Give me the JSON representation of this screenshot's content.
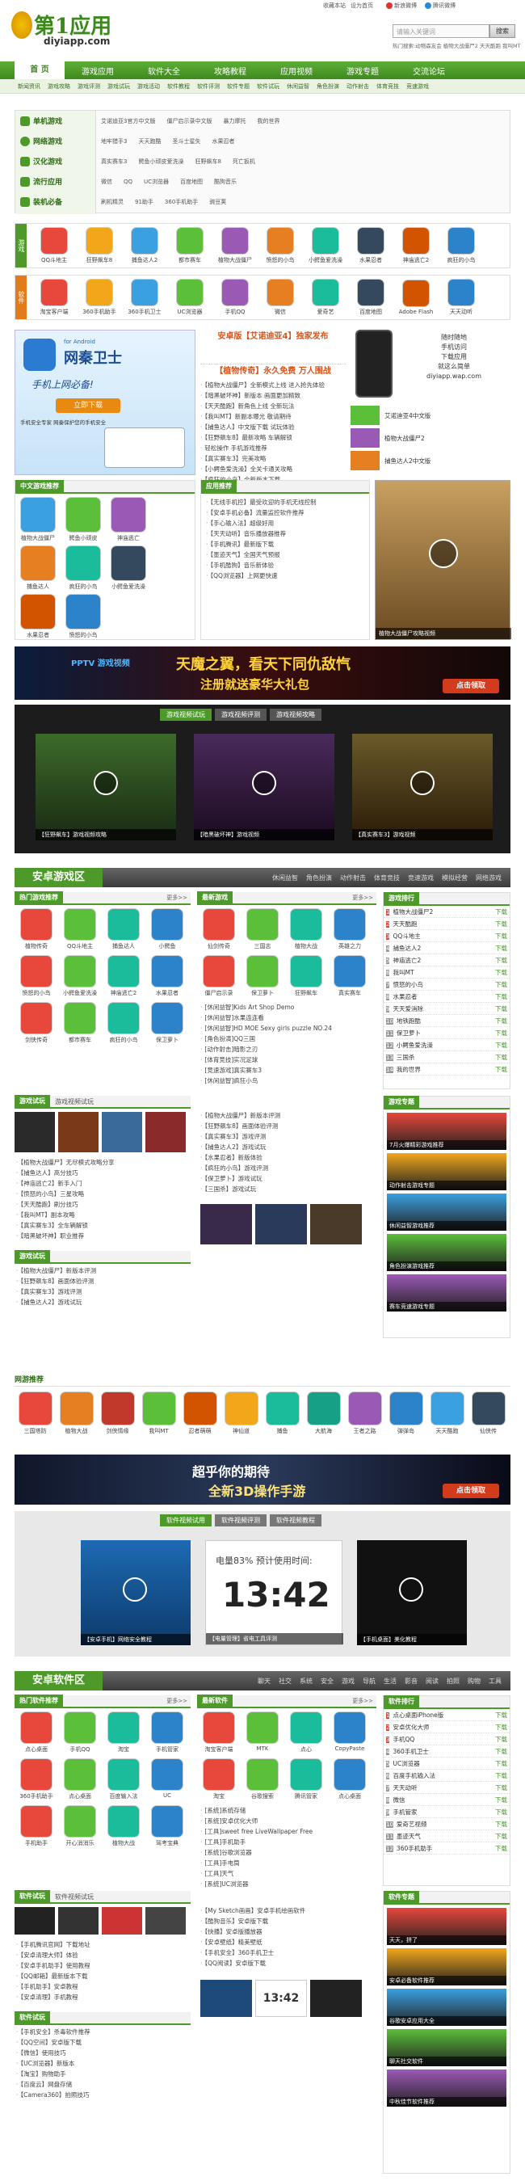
{
  "site": {
    "logo_cn": "第1应用",
    "logo_url": "diyiapp.com",
    "top_links": [
      "收藏本站",
      "设为首页"
    ],
    "weibo": [
      "新浪微博",
      "腾讯微博"
    ],
    "search_placeholder": "请输入关键词",
    "search_button": "搜索",
    "hotwords": "热门搜索:动物森友会 植物大战僵尸2 天天酷跑 我叫MT"
  },
  "nav": [
    "首 页",
    "游戏应用",
    "软件大全",
    "攻略教程",
    "应用视频",
    "游戏专题",
    "交流论坛"
  ],
  "subnav": [
    "新闻资讯",
    "游戏攻略",
    "游戏评测",
    "游戏试玩",
    "游戏活动",
    "软件教程",
    "软件评测",
    "软件专题",
    "软件试玩",
    "休闲益智",
    "角色扮演",
    "动作射击",
    "体育竞技",
    "竞速游戏"
  ],
  "categories": [
    "单机游戏",
    "网络游戏",
    "汉化游戏",
    "流行应用",
    "装机必备"
  ],
  "category_links": [
    [
      "艾诺迪亚3官方中文版",
      "僵尸启示录中文版",
      "暴力摩托",
      "我的世界"
    ],
    [
      "地牢猎手3",
      "天天跑酷",
      "圣斗士星矢",
      "水果忍者"
    ],
    [
      "真实赛车3",
      "鳄鱼小顽皮爱洗澡",
      "狂野飙车8",
      "死亡扳机"
    ],
    [
      "微信",
      "QQ",
      "UC浏览器",
      "百度地图",
      "酷狗音乐"
    ],
    [
      "刷机精灵",
      "91助手",
      "360手机助手",
      "豌豆荚"
    ]
  ],
  "game_row": [
    "QQ斗地主",
    "狂野飙车8",
    "捕鱼达人2",
    "都市赛车",
    "植物大战僵尸",
    "愤怒的小鸟",
    "小鳄鱼爱洗澡",
    "水果忍者",
    "神庙逃亡2",
    "疯狂的小鸟"
  ],
  "app_row": [
    "淘宝客户端",
    "360手机助手",
    "360手机卫士",
    "UC浏览器",
    "手机QQ",
    "微信",
    "爱奇艺",
    "百度地图",
    "Adobe Flash",
    "天天动听"
  ],
  "feature": {
    "ad_title": "网秦卫士",
    "ad_sub": "for Android",
    "ad_tag": "手机上网必备!",
    "ad_btn": "立即下载",
    "ad_desc": "手机安全专家 网秦保护您的手机安全",
    "headline1": "安卓版【艾诺迪亚4】独家发布",
    "headline2": "【植物传奇】永久免费 万人围战",
    "news": [
      "【植物大战僵尸】全新模式上线 进入抢先体验",
      "【暗黑破坏神】新版本 画面更加精致",
      "【天天酷跑】新角色上线 全新玩法",
      "【我叫MT】新副本曝光 敬请期待",
      "【捕鱼达人】中文版下载 试玩体验",
      "【狂野飙车8】最新攻略 车辆解锁",
      "轻松操作 手机游戏推荐",
      "【真实赛车3】完美攻略",
      "【小鳄鱼爱洗澡】全关卡通关攻略",
      "【疯狂的小鸟】全新版本下载"
    ],
    "phone_text": [
      "随时随地",
      "手机访问",
      "下载应用",
      "就这么简单",
      "diyiapp.wap.com"
    ],
    "side_items": [
      "艾诺迪亚4中文版",
      "植物大战僵尸2",
      "捕鱼达人2中文版"
    ]
  },
  "panels": {
    "left_title": "中文游戏推荐",
    "mid_title": "应用推荐",
    "mid_list": [
      "【无线手机控】最受欢迎的手机无线控制",
      "【安卓手机必备】流量监控软件推荐",
      "【手心输入法】超级好用",
      "【天天动听】音乐播放器推荐",
      "【手机腾讯】最新版下载",
      "【墨迹天气】全国天气预报",
      "【手机酷狗】音乐新体验",
      "【QQ浏览器】上网更快速"
    ],
    "left_items": [
      "植物大战僵尸",
      "鳄鱼小顽皮",
      "神庙逃亡",
      "捕鱼达人",
      "疯狂的小鸟",
      "小鳄鱼爱洗澡",
      "水果忍者",
      "愤怒的小鸟"
    ],
    "right_cap": "植物大战僵尸攻略视频"
  },
  "banner1": {
    "left": "PPTV 游戏视频",
    "text": "天魔之翼，看天下同仇敌忾",
    "sub": "注册就送豪华大礼包",
    "btn": "点击领取"
  },
  "video_tabs": [
    "游戏视频试玩",
    "游戏视频评测",
    "游戏视频攻略"
  ],
  "videos": [
    {
      "cap": "【狂野飙车】游戏视频攻略"
    },
    {
      "cap": "【暗黑破坏神】游戏视频"
    },
    {
      "cap": "【真实赛车3】游戏视频"
    }
  ],
  "android_games": {
    "title": "安卓游戏区",
    "tabs": [
      "休闲益智",
      "角色扮演",
      "动作射击",
      "体育竞技",
      "竞速游戏",
      "模拟经营",
      "网络游戏"
    ],
    "hot_title": "热门游戏推荐",
    "new_title": "最新游戏",
    "more": "更多>>",
    "hot": [
      "植物传奇",
      "QQ斗地主",
      "捕鱼达人",
      "小鳄鱼",
      "愤怒的小鸟",
      "小鳄鱼爱洗澡",
      "神庙逃亡2",
      "水果忍者",
      "剑侠传奇",
      "都市赛车",
      "疯狂的小鸟",
      "保卫萝卜"
    ],
    "latest": [
      "仙剑传奇",
      "三国志",
      "植物大战",
      "英雄之力",
      "僵尸启示录",
      "保卫萝卜",
      "狂野飙车",
      "真实赛车"
    ],
    "latest_list": [
      "[休闲益智]Kids Art Shop Demo",
      "[休闲益智]水果连连看",
      "[休闲益智]HD MOE Sexy girls puzzle NO.24",
      "[角色扮演]QQ三国",
      "[动作射击]暗影之刃",
      "[体育竞技]实况足球",
      "[竞速游戏]真实赛车3",
      "[休闲益智]疯狂小鸟"
    ],
    "rank_title": "游戏排行",
    "rank": [
      "植物大战僵尸2",
      "天天酷跑",
      "QQ斗地主",
      "捕鱼达人2",
      "神庙逃亡2",
      "我叫MT",
      "愤怒的小鸟",
      "水果忍者",
      "天天爱消除",
      "地铁跑酷",
      "保卫萝卜",
      "小鳄鱼爱洗澡",
      "三国杀",
      "我的世界"
    ],
    "rank_dl": "下载",
    "topic_title": "游戏专题",
    "topics": [
      "7月火爆精彩游戏推荐",
      "动作射击游戏专题",
      "休闲益智游戏推荐",
      "角色扮演游戏推荐",
      "赛车竞速游戏专题"
    ]
  },
  "game_news": {
    "tabs": [
      "游戏试玩",
      "游戏视频试玩"
    ],
    "list": [
      "【植物大战僵尸】无尽模式攻略分享",
      "【捕鱼达人】高分技巧",
      "【神庙逃亡2】新手入门",
      "【愤怒的小鸟】三星攻略",
      "【天天酷跑】刷分技巧",
      "【我叫MT】副本攻略",
      "【真实赛车3】全车辆解锁",
      "【暗黑破坏神】职业推荐"
    ],
    "mid_list": [
      "【植物大战僵尸】新版本评测",
      "【狂野飙车8】画面体验评测",
      "【真实赛车3】游戏评测",
      "【捕鱼达人2】游戏试玩",
      "【水果忍者】新版体验",
      "【疯狂的小鸟】游戏评测",
      "【保卫萝卜】游戏试玩",
      "【三国杀】游戏试玩"
    ]
  },
  "netgames": {
    "title": "网游推荐",
    "items": [
      "三国塔防",
      "植物大战",
      "剑侠情缘",
      "我叫MT",
      "忍者萌萌",
      "神仙道",
      "捕鱼",
      "大航海",
      "王者之路",
      "弹弹岛",
      "天天酷跑",
      "仙侠传"
    ]
  },
  "banner2": {
    "text": "超乎你的期待",
    "sub": "全新3D操作手游",
    "btn": "点击领取"
  },
  "soft_video_tabs": [
    "软件视频试用",
    "软件视频评测",
    "软件视频教程"
  ],
  "soft_videos": [
    {
      "cap": "【安卓手机】网络安全教程"
    },
    {
      "cap": "【电量管理】省电工具评测",
      "clock": "13:42",
      "battery": "电量83%  预计使用时间:"
    },
    {
      "cap": "【手机桌面】美化教程"
    }
  ],
  "android_apps": {
    "title": "安卓软件区",
    "tabs": [
      "聊天",
      "社交",
      "系统",
      "安全",
      "游戏",
      "导航",
      "生活",
      "影音",
      "阅读",
      "拍照",
      "购物",
      "工具"
    ],
    "hot_title": "热门软件推荐",
    "new_title": "最新软件",
    "more": "更多>>",
    "hot": [
      "点心桌面",
      "手机QQ",
      "淘宝",
      "手机管家",
      "360手机助手",
      "点心桌面",
      "百度输入法",
      "UC",
      "手机助手",
      "开心消消乐",
      "植物大战",
      "驾考宝典"
    ],
    "latest": [
      "淘宝客户端",
      "MTK",
      "点心",
      "CopyPaste",
      "淘宝",
      "谷歌搜索",
      "腾讯管家",
      "点心桌面"
    ],
    "latest_list": [
      "[系统]系统存储",
      "[系统]安卓优化大师",
      "[工具]sweet free LiveWallpaper Free",
      "[工具]手机助手",
      "[系统]谷歌浏览器",
      "[工具]手电筒",
      "[工具]天气",
      "[系统]UC浏览器"
    ],
    "rank_title": "软件排行",
    "rank": [
      "点心桌面iPhone版",
      "安卓优化大师",
      "手机QQ",
      "360手机卫士",
      "UC浏览器",
      "百度手机输入法",
      "天天动听",
      "微信",
      "手机管家",
      "爱奇艺视频",
      "墨迹天气",
      "360手机助手"
    ],
    "rank_dl": "下载",
    "topic_title": "软件专题",
    "topics": [
      "天天，拼了",
      "安卓必备软件推荐",
      "谷歌安卓应用大全",
      "聊天社交软件",
      "中秋佳节软件推荐"
    ]
  },
  "soft_news": {
    "tabs": [
      "软件试玩",
      "软件视频试玩"
    ],
    "list": [
      "【手机腾讯官网】下载地址",
      "【安卓清理大师】体验",
      "【安卓手机助手】使用教程",
      "【QQ邮箱】最新版本下载",
      "【手机助手】安卓教程",
      "【安卓清理】手机教程"
    ],
    "mid_list": [
      "【My Sketch画画】安卓手机绘画软件",
      "【酷狗音乐】安卓版下载",
      "【快播】安卓版播放器",
      "【安卓壁纸】精美壁纸",
      "【手机安全】360手机卫士",
      "【QQ阅读】安卓版下载"
    ],
    "bottom_list": [
      "【手机安全】杀毒软件推荐",
      "【QQ空间】安卓版下载",
      "【微信】使用技巧",
      "【UC浏览器】新版本",
      "【淘宝】购物助手",
      "【百度云】网盘存储",
      "【Camera360】拍照技巧"
    ],
    "app_clock": "13:42"
  }
}
